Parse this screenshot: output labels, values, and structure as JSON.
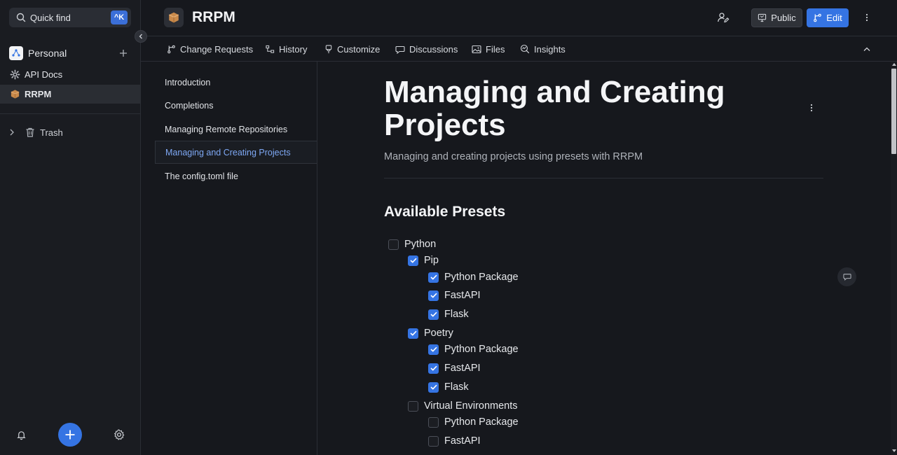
{
  "sidebar": {
    "quick_find": "Quick find",
    "shortcut": "^K",
    "space_name": "Personal",
    "items": [
      {
        "label": "API Docs"
      },
      {
        "label": "RRPM"
      }
    ],
    "trash": "Trash"
  },
  "header": {
    "title": "RRPM",
    "public_label": "Public",
    "edit_label": "Edit"
  },
  "tabs": [
    {
      "label": "Change Requests"
    },
    {
      "label": "History"
    },
    {
      "label": "Customize"
    },
    {
      "label": "Discussions"
    },
    {
      "label": "Files"
    },
    {
      "label": "Insights"
    }
  ],
  "toc": [
    {
      "label": "Introduction"
    },
    {
      "label": "Completions"
    },
    {
      "label": "Managing Remote Repositories"
    },
    {
      "label": "Managing and Creating Projects"
    },
    {
      "label": "The config.toml file"
    }
  ],
  "page": {
    "title": "Managing and Creating Projects",
    "description": "Managing and creating projects using presets with RRPM",
    "section_heading": "Available Presets",
    "checklist": [
      {
        "label": "Python",
        "checked": false,
        "level": 0
      },
      {
        "label": "Pip",
        "checked": true,
        "level": 1
      },
      {
        "label": "Python Package",
        "checked": true,
        "level": 2
      },
      {
        "label": "FastAPI",
        "checked": true,
        "level": 2
      },
      {
        "label": "Flask",
        "checked": true,
        "level": 2
      },
      {
        "label": "Poetry",
        "checked": true,
        "level": 1
      },
      {
        "label": "Python Package",
        "checked": true,
        "level": 2
      },
      {
        "label": "FastAPI",
        "checked": true,
        "level": 2
      },
      {
        "label": "Flask",
        "checked": true,
        "level": 2
      },
      {
        "label": "Virtual Environments",
        "checked": false,
        "level": 1
      },
      {
        "label": "Python Package",
        "checked": false,
        "level": 2
      },
      {
        "label": "FastAPI",
        "checked": false,
        "level": 2
      }
    ]
  },
  "colors": {
    "accent": "#3574e3",
    "background": "#16181d",
    "active_link": "#7ea8f4"
  }
}
